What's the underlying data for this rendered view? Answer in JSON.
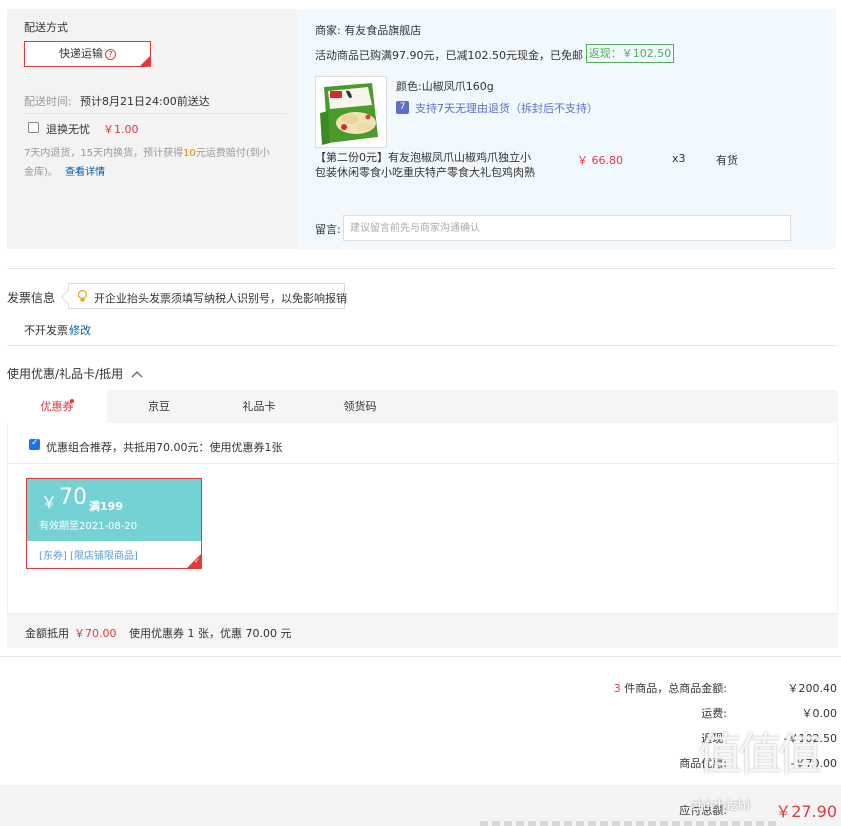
{
  "shipping": {
    "title": "配送方式",
    "method": "快递运输",
    "help_icon": "question-circle-icon",
    "time_label": "配送时间:",
    "time_value": "预计8月21日24:00前送达",
    "no_worry_label": "退换无忧",
    "no_worry_price": "￥1.00",
    "no_worry_checked": false,
    "desc_1": "7天内退货，15天内换货，预计获得",
    "desc_highlight": "10",
    "desc_2": "元运费赔付(到小",
    "desc_3": "金库)。",
    "detail_link": "查看详情"
  },
  "shop": {
    "seller_label": "商家:",
    "seller_name": "有友食品旗舰店",
    "promo_text": "活动商品已购满97.90元，已减102.50元现金，已免邮",
    "rebate_badge": "返现：￥102.50",
    "product": {
      "image_icon": "product-image",
      "color_label": "颜色:",
      "color_value": "山椒凤爪160g",
      "return_icon": "seven-day-return-icon",
      "return_text": "支持7天无理由退货（拆封后不支持）",
      "name_line1": "【第二份0元】有友泡椒凤爪山椒鸡爪独立小",
      "name_line2": "包装休闲零食小吃重庆特产零食大礼包鸡肉熟",
      "price": "￥ 66.80",
      "qty": "x3",
      "stock": "有货"
    },
    "memo_label": "留言:",
    "memo_placeholder": "建议留言前先与商家沟通确认"
  },
  "invoice": {
    "title": "发票信息",
    "tip_icon": "lightbulb-icon",
    "tip": "开企业抬头发票须填写纳税人识别号，以免影响报销",
    "value": "不开发票",
    "edit": "修改"
  },
  "coupons": {
    "title": "使用优惠/礼品卡/抵用",
    "toggle_icon": "chevron-up-icon",
    "tabs": [
      "优惠券",
      "京豆",
      "礼品卡",
      "领货码"
    ],
    "active_tab": 0,
    "recommend_checked": true,
    "recommend_text": "优惠组合推荐，共抵用70.00元：使用优惠券1张",
    "card": {
      "currency": "￥",
      "amount": "70",
      "condition": "满199",
      "validity": "有效期至2021-08-20",
      "tags": "[东券] [限店铺限商品]"
    },
    "footer_label": "金额抵用",
    "footer_amount": "￥70.00",
    "footer_desc": "使用优惠券 1 张，优惠 70.00 元"
  },
  "summary": {
    "items_count": "3",
    "items_label": "件商品，总商品金额:",
    "items_value": "￥200.40",
    "freight_label": "运费:",
    "freight_value": "￥0.00",
    "rebate_label": "返现:",
    "rebate_value": "-￥102.50",
    "discount_label": "商品优惠:",
    "discount_value": "-￥70.00",
    "payable_label": "应付总额:",
    "payable_value": "￥27.90"
  },
  "watermark": {
    "glyphs": "值值值",
    "text": "zhizhizhi"
  },
  "colors": {
    "accent": "#e4393c",
    "coupon": "#74d2d4",
    "rebate": "#4caf50",
    "link": "#005ea7"
  }
}
